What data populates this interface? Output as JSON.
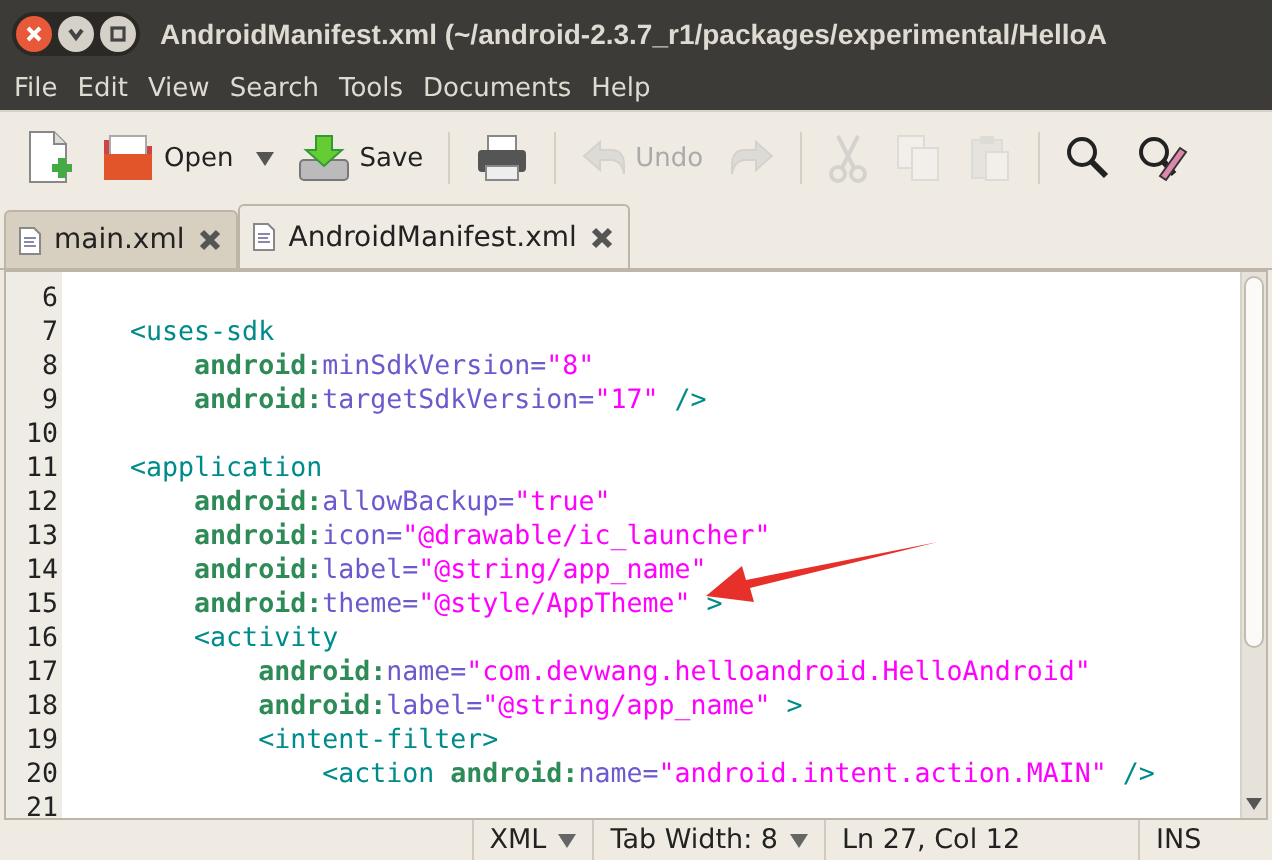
{
  "window": {
    "title": "AndroidManifest.xml (~/android-2.3.7_r1/packages/experimental/HelloA"
  },
  "menu": [
    "File",
    "Edit",
    "View",
    "Search",
    "Tools",
    "Documents",
    "Help"
  ],
  "toolbar": [
    {
      "kind": "new",
      "disabled": false
    },
    {
      "kind": "open",
      "label": "Open",
      "disabled": false
    },
    {
      "kind": "dropdown",
      "disabled": false
    },
    {
      "kind": "save",
      "label": "Save",
      "disabled": false
    },
    {
      "kind": "sep"
    },
    {
      "kind": "print",
      "disabled": false
    },
    {
      "kind": "sep"
    },
    {
      "kind": "undo",
      "label": "Undo",
      "disabled": true
    },
    {
      "kind": "redo",
      "disabled": true
    },
    {
      "kind": "sep"
    },
    {
      "kind": "cut",
      "disabled": true
    },
    {
      "kind": "copy",
      "disabled": true
    },
    {
      "kind": "paste",
      "disabled": true
    },
    {
      "kind": "sep"
    },
    {
      "kind": "find",
      "disabled": false
    },
    {
      "kind": "replace",
      "disabled": false
    }
  ],
  "tabs": [
    {
      "label": "main.xml",
      "selected": false
    },
    {
      "label": "AndroidManifest.xml",
      "selected": true
    }
  ],
  "editor": {
    "lines": [
      {
        "number": "6"
      },
      {
        "number": "7",
        "tokens": [
          {
            "kind": "tag",
            "text": "    <uses-sdk"
          }
        ]
      },
      {
        "number": "8",
        "tokens": [
          {
            "kind": "ns",
            "text": "        android:"
          },
          {
            "kind": "attr",
            "text": "minSdkVersion="
          },
          {
            "kind": "str",
            "text": "\"8\""
          }
        ]
      },
      {
        "number": "9",
        "tokens": [
          {
            "kind": "ns",
            "text": "        android:"
          },
          {
            "kind": "attr",
            "text": "targetSdkVersion="
          },
          {
            "kind": "str",
            "text": "\"17\""
          },
          {
            "kind": "tag",
            "text": " />"
          }
        ]
      },
      {
        "number": "10"
      },
      {
        "number": "11",
        "tokens": [
          {
            "kind": "tag",
            "text": "    <application"
          }
        ]
      },
      {
        "number": "12",
        "tokens": [
          {
            "kind": "ns",
            "text": "        android:"
          },
          {
            "kind": "attr",
            "text": "allowBackup="
          },
          {
            "kind": "str",
            "text": "\"true\""
          }
        ]
      },
      {
        "number": "13",
        "tokens": [
          {
            "kind": "ns",
            "text": "        android:"
          },
          {
            "kind": "attr",
            "text": "icon="
          },
          {
            "kind": "str",
            "text": "\"@drawable/ic_launcher\""
          }
        ]
      },
      {
        "number": "14",
        "tokens": [
          {
            "kind": "ns",
            "text": "        android:"
          },
          {
            "kind": "attr",
            "text": "label="
          },
          {
            "kind": "str",
            "text": "\"@string/app_name\""
          }
        ]
      },
      {
        "number": "15",
        "tokens": [
          {
            "kind": "ns",
            "text": "        android:"
          },
          {
            "kind": "attr",
            "text": "theme="
          },
          {
            "kind": "str",
            "text": "\"@style/AppTheme\""
          },
          {
            "kind": "tag",
            "text": " >"
          }
        ]
      },
      {
        "number": "16",
        "tokens": [
          {
            "kind": "tag",
            "text": "        <activity"
          }
        ]
      },
      {
        "number": "17",
        "tokens": [
          {
            "kind": "ns",
            "text": "            android:"
          },
          {
            "kind": "attr",
            "text": "name="
          },
          {
            "kind": "str",
            "text": "\"com.devwang.helloandroid.HelloAndroid\""
          }
        ]
      },
      {
        "number": "18",
        "tokens": [
          {
            "kind": "ns",
            "text": "            android:"
          },
          {
            "kind": "attr",
            "text": "label="
          },
          {
            "kind": "str",
            "text": "\"@string/app_name\""
          },
          {
            "kind": "tag",
            "text": " >"
          }
        ]
      },
      {
        "number": "19",
        "tokens": [
          {
            "kind": "tag",
            "text": "            <intent-filter>"
          }
        ]
      },
      {
        "number": "20",
        "tokens": [
          {
            "kind": "tag",
            "text": "                <action "
          },
          {
            "kind": "ns",
            "text": "android:"
          },
          {
            "kind": "attr",
            "text": "name="
          },
          {
            "kind": "str",
            "text": "\"android.intent.action.MAIN\""
          },
          {
            "kind": "tag",
            "text": " />"
          }
        ]
      },
      {
        "number": "21"
      }
    ]
  },
  "status_bar": {
    "language": "XML",
    "tab_width": "Tab Width:  8",
    "position": "Ln 27, Col 12",
    "mode": "INS"
  }
}
